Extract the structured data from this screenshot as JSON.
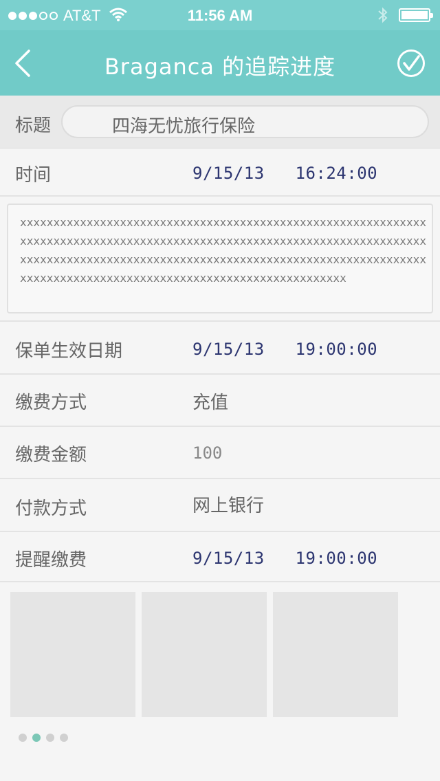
{
  "status_bar": {
    "carrier": "AT&T",
    "time": "11:56 AM",
    "signal_bars": 3,
    "signal_total": 5
  },
  "nav": {
    "title": "Braganca 的追踪进度"
  },
  "form": {
    "title_label": "标题",
    "title_value": "四海无忧旅行保险",
    "time_label": "时间",
    "time_value": "9/15/13   16:24:00",
    "memo": "xxxxxxxxxxxxxxxxxxxxxxxxxxxxxxxxxxxxxxxxxxxxxxxxxxxxxxxxxxxxxxxxxxxxxxxxxxxxxxxxxxxxxxxxxxxxxxxxxxxxxxxxxxxxxxxxxxxxxxxxxxxxxxxxxxxxxxxxxxxxxxxxxxxxxxxxxxxxxxxxxxxxxxxxxxxxxxxxxxxxxxxxxxxxxxxxxxxxxxxxxxxxxxxxxxxxxxxxxxxxxxxxxxxxxxxx",
    "rows": [
      {
        "label": "保单生效日期",
        "value": "9/15/13   19:00:00"
      },
      {
        "label": "缴费方式",
        "value": "充值"
      },
      {
        "label": "缴费金额",
        "value": "100"
      },
      {
        "label": "付款方式",
        "value": "网上银行"
      },
      {
        "label": "提醒缴费",
        "value": "9/15/13   19:00:00"
      }
    ]
  },
  "gallery": {
    "image_count": 3,
    "page_count": 4,
    "active_page": 2
  },
  "colors": {
    "status_bar": "#7bd0ce",
    "nav_bar": "#71cbc8",
    "datetime_text": "#2c3570",
    "active_page_dot": "#7bc7b6"
  }
}
